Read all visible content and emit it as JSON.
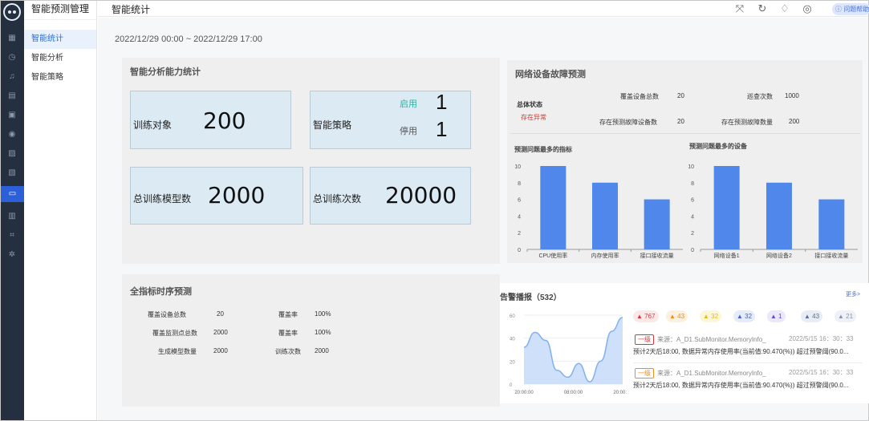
{
  "app": {
    "menu_title": "智能预测管理",
    "page_title": "智能统计",
    "help": "问题帮助"
  },
  "menu": {
    "items": [
      {
        "label": "智能统计"
      },
      {
        "label": "智能分析"
      },
      {
        "label": "智能策略"
      }
    ]
  },
  "date_range": "2022/12/29  00:00  ~  2022/12/29  17:00",
  "ability": {
    "title": "智能分析能力统计",
    "train_object_label": "训练对象",
    "train_object_value": "200",
    "policy_label": "智能策略",
    "enabled_label": "启用",
    "enabled_value": "1",
    "disabled_label": "停用",
    "disabled_value": "1",
    "models_label": "总训练模型数",
    "models_value": "2000",
    "times_label": "总训练次数",
    "times_value": "20000"
  },
  "fault": {
    "title": "网络设备故障预测",
    "status_label": "总体状态",
    "status_value": "存在异常",
    "cover_label": "覆盖设备总数",
    "cover_value": "20",
    "inspect_label": "巡查次数",
    "inspect_value": "1000",
    "predict_dev_label": "存在预测故障设备数",
    "predict_dev_value": "20",
    "predict_cnt_label": "存在预测故障数量",
    "predict_cnt_value": "200",
    "chart1_title": "预测问题最多的指标",
    "chart2_title": "预测问题最多的设备"
  },
  "timeseries": {
    "title": "全指标时序预测",
    "rows": [
      {
        "l1": "覆盖设备总数",
        "v1": "20",
        "l2": "覆盖率",
        "v2": "100%"
      },
      {
        "l1": "覆盖监测点总数",
        "v1": "2000",
        "l2": "覆盖率",
        "v2": "100%"
      },
      {
        "l1": "生成模型数量",
        "v1": "2000",
        "l2": "训练次数",
        "v2": "2000"
      }
    ]
  },
  "alarm": {
    "title": "告警播报（532）",
    "more": "更多>",
    "badges": [
      {
        "value": "767",
        "color": "#d9363e",
        "bg": "#fde8e8"
      },
      {
        "value": "43",
        "color": "#f08c1a",
        "bg": "#fdf0df"
      },
      {
        "value": "32",
        "color": "#e8b80c",
        "bg": "#fdf7d9"
      },
      {
        "value": "32",
        "color": "#3d63c9",
        "bg": "#e5ebfa"
      },
      {
        "value": "1",
        "color": "#5f4fc4",
        "bg": "#ebe8fa"
      },
      {
        "value": "43",
        "color": "#5a6f99",
        "bg": "#e8edf5"
      },
      {
        "value": "21",
        "color": "#8896ad",
        "bg": "#eef1f6"
      }
    ],
    "items": [
      {
        "level": "一级",
        "level_color": "#d9363e",
        "source": "来源：A_D1.SubMonitor.MemoryInfo_",
        "time": "2022/5/15 16：30：33",
        "text": "预计2天后18:00, 数据异常内存使用率(当前值:90.470(%)) 超过预警阈(90.0..."
      },
      {
        "level": "一级",
        "level_color": "#f08c1a",
        "source": "来源：A_D1.SubMonitor.MemoryInfo_",
        "time": "2022/5/15 16：30：33",
        "text": "预计2天后18:00, 数据异常内存使用率(当前值:90.470(%)) 超过预警阈(90.0..."
      }
    ]
  },
  "chart_data": [
    {
      "type": "bar",
      "title": "预测问题最多的指标",
      "categories": [
        "CPU使用率",
        "内存使用率",
        "接口接收流量"
      ],
      "values": [
        10,
        8,
        6
      ],
      "ylim": [
        0,
        10
      ],
      "yticks": [
        "0",
        "2",
        "4",
        "6",
        "8",
        "10"
      ],
      "color": "#4f87ea"
    },
    {
      "type": "bar",
      "title": "预测问题最多的设备",
      "categories": [
        "网络设备1",
        "网络设备2",
        "接口接收流量"
      ],
      "values": [
        10,
        8,
        6
      ],
      "ylim": [
        0,
        10
      ],
      "yticks": [
        "0",
        "2",
        "4",
        "6",
        "8",
        "10"
      ],
      "color": "#4f87ea"
    },
    {
      "type": "area",
      "x": [
        "20:00:00",
        "08:00:00",
        "20:00:00"
      ],
      "yticks": [
        "0",
        "20",
        "40",
        "60"
      ],
      "ylim": [
        0,
        60
      ],
      "values": [
        32,
        45,
        38,
        12,
        6,
        18,
        2,
        20,
        46,
        58
      ],
      "color": "#7fb0f0"
    }
  ]
}
